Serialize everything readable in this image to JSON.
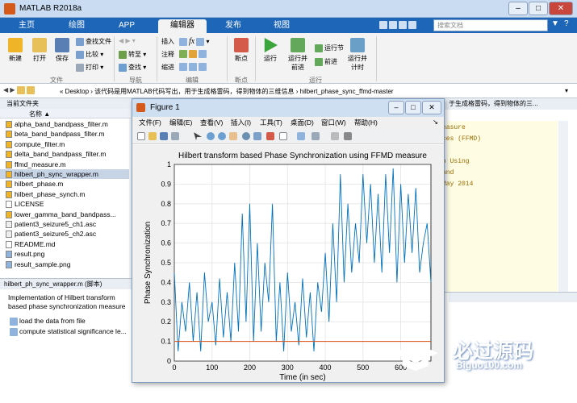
{
  "window": {
    "title": "MATLAB R2018a",
    "minimize": "–",
    "maximize": "□",
    "close": "✕"
  },
  "tabs": [
    {
      "label": "主页"
    },
    {
      "label": "绘图"
    },
    {
      "label": "APP"
    },
    {
      "label": "编辑器",
      "active": true
    },
    {
      "label": "发布"
    },
    {
      "label": "视图"
    }
  ],
  "search": {
    "placeholder": "搜索文档"
  },
  "ribbon": {
    "file": {
      "new": "新建",
      "open": "打开",
      "save": "保存",
      "find_files": "查找文件",
      "compare": "比较",
      "print": "打印",
      "group": "文件"
    },
    "navigate": {
      "goto": "转至",
      "find": "查找",
      "group": "导航"
    },
    "edit": {
      "insert": "插入",
      "comment": "注释",
      "indent": "缩进",
      "fx": "fx",
      "group": "编辑"
    },
    "breakpoints": {
      "label": "断点",
      "group": "断点"
    },
    "run": {
      "run": "运行",
      "run_advance": "运行并\n前进",
      "run_section": "运行节",
      "advance": "前进",
      "run_time": "运行并\n计时",
      "group": "运行"
    }
  },
  "address": {
    "path": "« Desktop › 该代码是用MATLAB代码写出，用于生成格雷码，得到物体的三维信息 › hilbert_phase_sync_ffmd-master"
  },
  "file_panel": {
    "title": "当前文件夹",
    "col_name": "名称 ▲",
    "files": [
      "alpha_band_bandpass_filter.m",
      "beta_band_bandpass_filter.m",
      "compute_filter.m",
      "delta_band_bandpass_filter.m",
      "ffmd_measure.m",
      "hilbert_ph_sync_wrapper.m",
      "hilbert_phase.m",
      "hilbert_phase_synch.m",
      "LICENSE",
      "lower_gamma_band_bandpass...",
      "patient3_seizure5_ch1.asc",
      "patient3_seizure5_ch2.asc",
      "README.md",
      "result.png",
      "result_sample.png"
    ],
    "selected_index": 5
  },
  "details": {
    "header": "hilbert_ph_sync_wrapper.m (脚本)",
    "desc": "Implementation of Hilbert transform based phase synchronization measure",
    "items": [
      "load the data from file",
      "compute statistical significance le..."
    ]
  },
  "editor": {
    "header_tail": "于生成格雷码，得到物体的三...",
    "code_lines": [
      "easure",
      "ces (FFMD)",
      "",
      "n Using",
      "and",
      "May 2014"
    ]
  },
  "figure": {
    "title": "Figure 1",
    "menu": [
      "文件(F)",
      "编辑(E)",
      "查看(V)",
      "插入(I)",
      "工具(T)",
      "桌面(D)",
      "窗口(W)",
      "帮助(H)"
    ]
  },
  "chart_data": {
    "type": "line",
    "title": "Hilbert transform based Phase Synchronization using FFMD measure",
    "xlabel": "Time (in sec)",
    "ylabel": "Phase Synchronization",
    "xlim": [
      0,
      680
    ],
    "ylim": [
      0,
      1
    ],
    "xticks": [
      0,
      100,
      200,
      300,
      400,
      500,
      600
    ],
    "yticks": [
      0,
      0.1,
      0.2,
      0.3,
      0.4,
      0.5,
      0.6,
      0.7,
      0.8,
      0.9,
      1
    ],
    "grid": true,
    "series": [
      {
        "color": "#0072bd",
        "x": [
          0,
          10,
          20,
          30,
          40,
          50,
          60,
          70,
          80,
          90,
          100,
          110,
          120,
          130,
          140,
          150,
          160,
          170,
          180,
          190,
          200,
          210,
          220,
          230,
          240,
          250,
          260,
          270,
          280,
          290,
          300,
          310,
          320,
          330,
          340,
          350,
          360,
          370,
          380,
          390,
          400,
          410,
          420,
          430,
          440,
          450,
          460,
          470,
          480,
          490,
          500,
          510,
          520,
          530,
          540,
          550,
          560,
          570,
          580,
          590,
          600,
          610,
          620,
          630,
          640,
          650,
          660,
          670,
          680
        ],
        "y": [
          0.45,
          0.05,
          0.3,
          0.15,
          0.4,
          0.1,
          0.35,
          0.05,
          0.45,
          0.2,
          0.3,
          0.08,
          0.42,
          0.12,
          0.35,
          0.1,
          0.5,
          0.15,
          0.75,
          0.2,
          0.8,
          0.1,
          0.6,
          0.15,
          0.5,
          0.3,
          0.8,
          0.1,
          0.4,
          0.05,
          0.45,
          0.15,
          0.3,
          0.08,
          0.42,
          0.12,
          0.35,
          0.05,
          0.4,
          0.25,
          0.55,
          0.2,
          0.7,
          0.3,
          0.95,
          0.4,
          0.8,
          0.45,
          0.7,
          0.5,
          0.95,
          0.6,
          0.9,
          0.5,
          0.85,
          0.45,
          0.95,
          0.55,
          0.98,
          0.4,
          0.9,
          0.5,
          0.85,
          0.55,
          0.88,
          0.45,
          0.6,
          0.7,
          0.4
        ]
      },
      {
        "color": "#d95319",
        "x": [
          0,
          680
        ],
        "y": [
          0.1,
          0.1
        ]
      }
    ]
  },
  "watermark": {
    "brand": "必过源码",
    "url": "Biguo100.com"
  }
}
